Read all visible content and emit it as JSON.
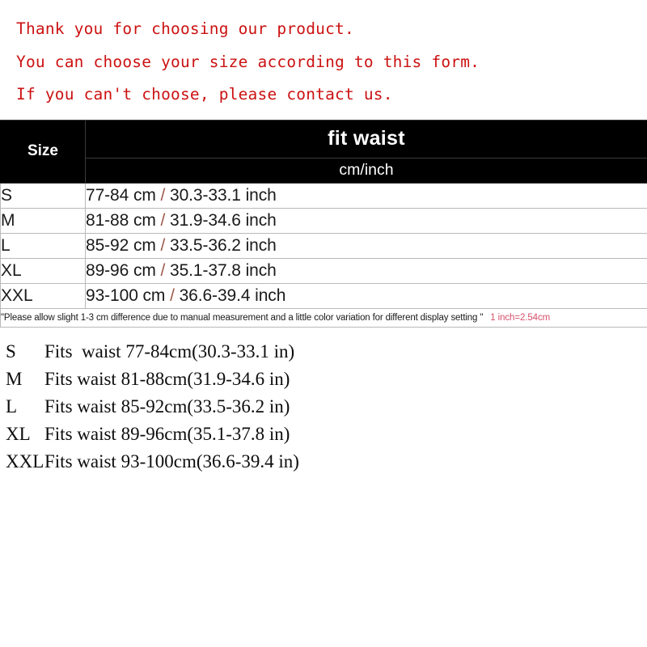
{
  "intro": {
    "lines": [
      "Thank you for choosing our product.",
      "You can choose your size according to this form.",
      "If you can't choose, please contact us."
    ],
    "color": "#cc1212"
  },
  "table": {
    "header": {
      "size_label": "Size",
      "title": "fit waist",
      "subtitle": "cm/inch",
      "background": "#000000",
      "text_color": "#ffffff"
    },
    "rows": [
      {
        "size": "S",
        "cm": "77-84 cm",
        "sep": "/",
        "inch": "30.3-33.1 inch"
      },
      {
        "size": "M",
        "cm": "81-88 cm",
        "sep": "/",
        "inch": "31.9-34.6 inch"
      },
      {
        "size": "L",
        "cm": "85-92 cm",
        "sep": "/",
        "inch": "33.5-36.2 inch"
      },
      {
        "size": "XL",
        "cm": "89-96 cm",
        "sep": "/",
        "inch": "35.1-37.8 inch"
      },
      {
        "size": "XXL",
        "cm": "93-100 cm",
        "sep": "/",
        "inch": "36.6-39.4 inch"
      }
    ],
    "note": {
      "text": "\"Please allow slight 1-3 cm difference due to manual measurement and a little color variation for different display setting \"",
      "conversion": "1 inch=2.54cm",
      "conversion_color": "#d4506a"
    }
  },
  "fit_list": [
    {
      "size": "S",
      "text": "Fits  waist 77-84cm(30.3-33.1 in)"
    },
    {
      "size": "M",
      "text": "Fits waist 81-88cm(31.9-34.6 in)"
    },
    {
      "size": "L",
      "text": "Fits waist 85-92cm(33.5-36.2 in)"
    },
    {
      "size": "XL",
      "text": "Fits waist 89-96cm(35.1-37.8 in)"
    },
    {
      "size": "XXL",
      "text": "Fits waist 93-100cm(36.6-39.4 in)"
    }
  ]
}
